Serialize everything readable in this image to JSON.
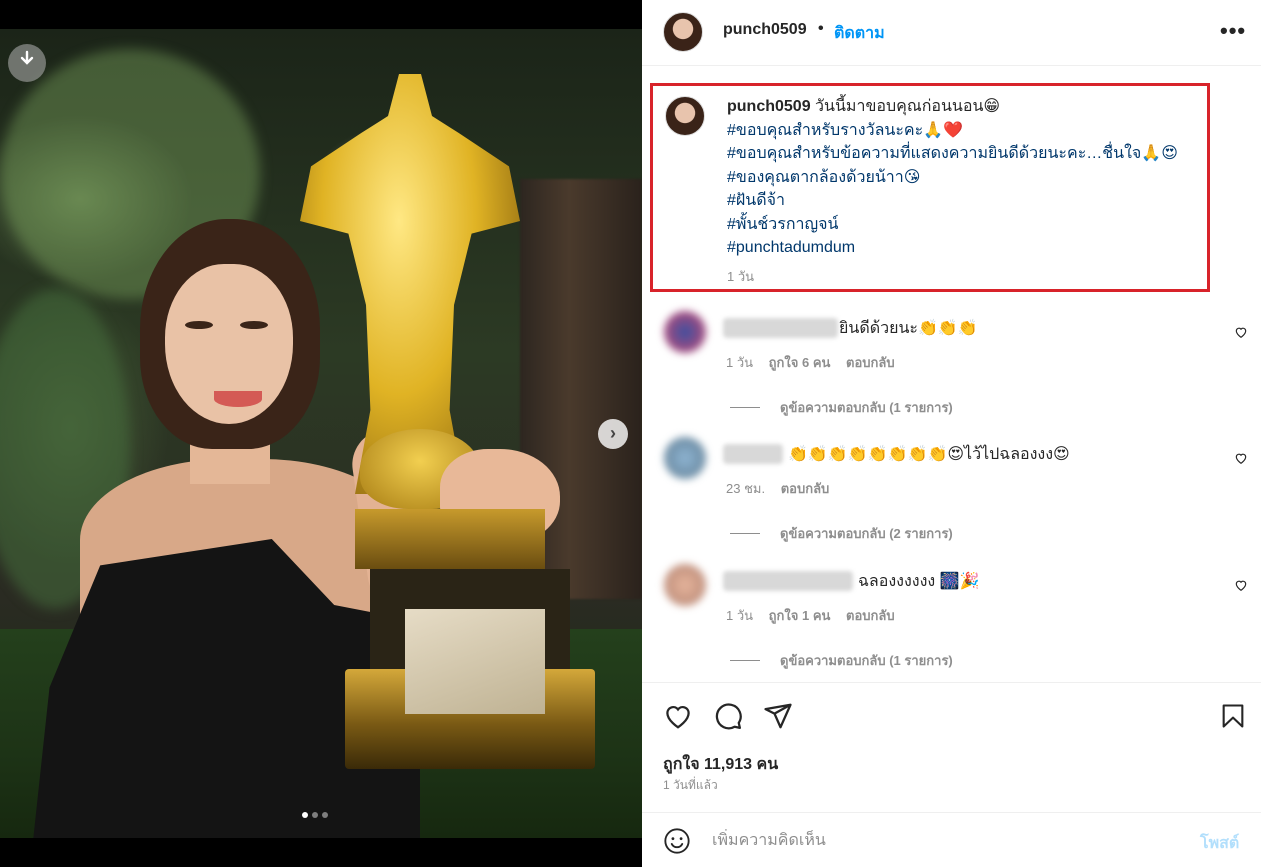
{
  "post": {
    "username": "punch0509",
    "follow_label": "ติดตาม",
    "separator": "•",
    "more_icon_text": "•••",
    "carousel": {
      "current": 1,
      "total": 3
    }
  },
  "caption": {
    "username": "punch0509",
    "text": "วันนี้มาขอบคุณก่อนนอน😁",
    "lines": [
      "#ขอบคุณสำหรับรางวัลนะคะ🙏❤️",
      "#ขอบคุณสำหรับข้อความที่แสดงความยินดีด้วยนะคะ…ชื่นใจ🙏😍",
      "#ของคุณตากล้องด้วยน้าา😘",
      "#ฝันดีจ้า",
      "#พั้นช์วรกาญจน์",
      "#punchtadumdum"
    ],
    "time": "1 วัน"
  },
  "comments": [
    {
      "text": "ยินดีด้วยนะ👏👏👏",
      "time": "1 วัน",
      "likes": "ถูกใจ 6 คน",
      "reply": "ตอบกลับ",
      "view_replies": "ดูข้อความตอบกลับ (1 รายการ)"
    },
    {
      "text": "👏👏👏👏👏👏👏👏😍ไว้ไปฉลองงง😍",
      "time": "23 ชม.",
      "likes": "",
      "reply": "ตอบกลับ",
      "view_replies": "ดูข้อความตอบกลับ (2 รายการ)"
    },
    {
      "text": "ฉลองงงงงง 🎆🎉",
      "time": "1 วัน",
      "likes": "ถูกใจ 1 คน",
      "reply": "ตอบกลับ",
      "view_replies": "ดูข้อความตอบกลับ (1 รายการ)"
    }
  ],
  "footer": {
    "likes": "ถูกใจ 11,913 คน",
    "time_ago": "1 วันที่แล้ว",
    "add_comment_placeholder": "เพิ่มความคิดเห็น",
    "post_label": "โพสต์"
  },
  "colors": {
    "accent": "#0095f6",
    "hashtag": "#00376b",
    "highlight_border": "#d8232a",
    "muted": "#8e8e8e",
    "post_disabled": "#b2dffc"
  },
  "icons": {
    "download": "download-icon",
    "next": "chevron-right-icon",
    "like": "heart-icon",
    "comment": "comment-icon",
    "share": "paper-plane-icon",
    "save": "bookmark-icon",
    "emoji": "smiley-icon",
    "more": "more-options-icon"
  }
}
